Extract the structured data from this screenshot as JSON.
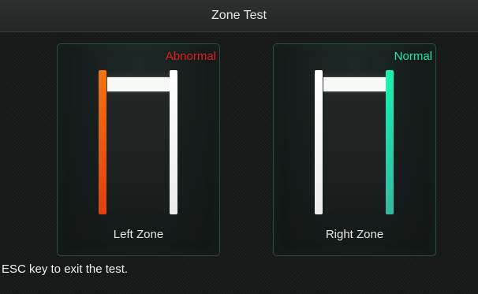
{
  "window": {
    "title": "Zone Test"
  },
  "zones": [
    {
      "label": "Left Zone",
      "status": "Abnormal",
      "status_color": "#e41c1c",
      "alert_post": "left",
      "alert_post_color": "#f1740d"
    },
    {
      "label": "Right Zone",
      "status": "Normal",
      "status_color": "#1ee6a3",
      "alert_post": "right",
      "alert_post_color": "#14f4b0"
    }
  ],
  "footer": {
    "hint": "ESC key to exit the test."
  },
  "icons": {
    "gate": "walk-through-gate-icon"
  }
}
